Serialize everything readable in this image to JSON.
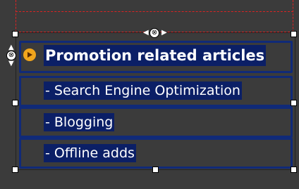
{
  "list": {
    "heading": "Promotion related articles",
    "items": [
      "- Search Engine Optimization",
      "- Blogging",
      "- Offline adds"
    ]
  },
  "icons": {
    "bullet": "circle-arrow-bullet-icon",
    "move": "move-handle-icon"
  },
  "colors": {
    "background": "#3b3b3b",
    "selection_fill": "#0b1f66",
    "row_border": "#102a78",
    "container_border": "#dd2222",
    "bullet": "#f1a51c"
  }
}
